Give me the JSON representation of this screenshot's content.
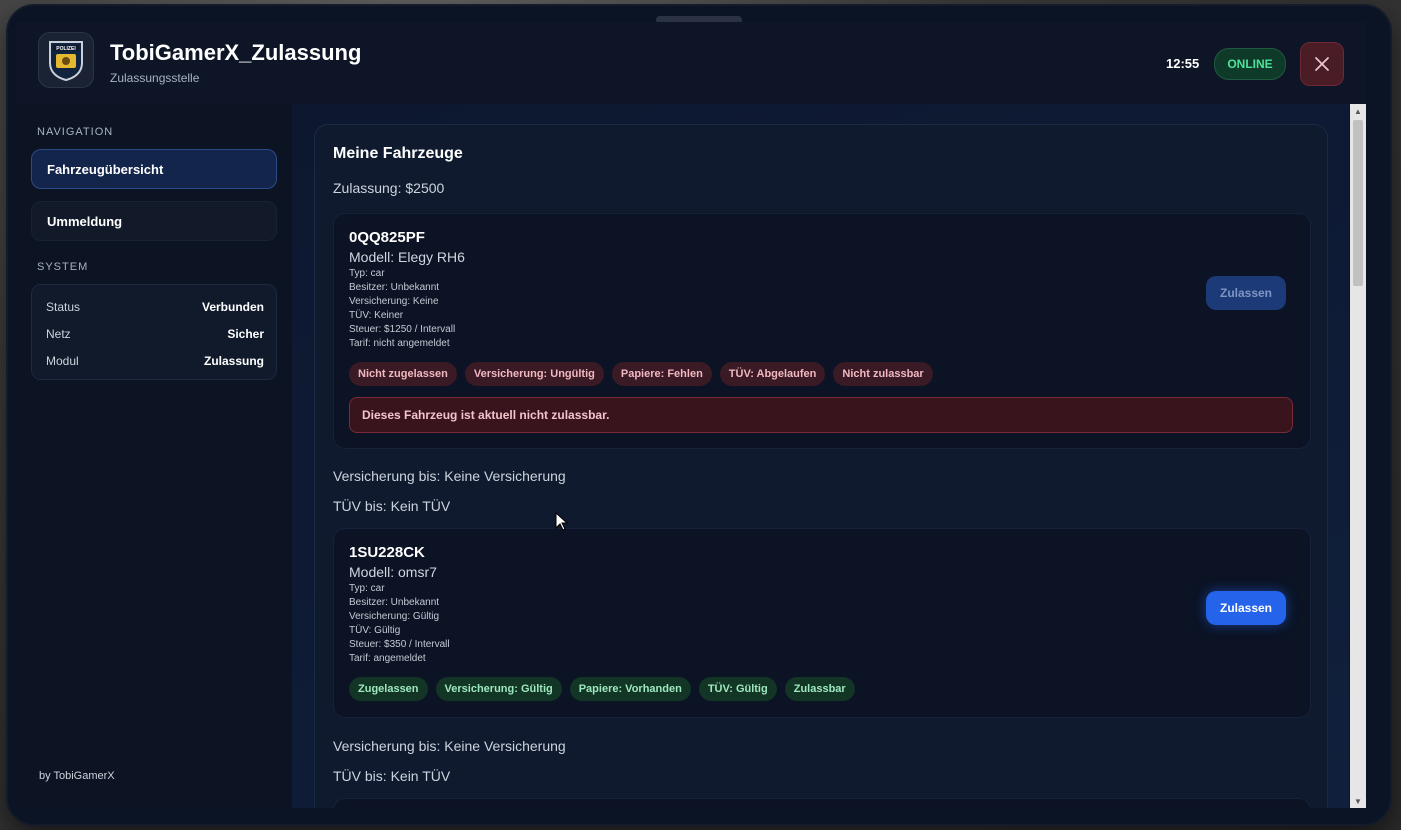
{
  "header": {
    "title": "TobiGamerX_Zulassung",
    "subtitle": "Zulassungsstelle",
    "logo_text": "POLIZEI",
    "clock": "12:55",
    "status_badge": "ONLINE",
    "close_icon": "close-icon"
  },
  "sidebar": {
    "nav_label": "NAVIGATION",
    "items": [
      {
        "label": "Fahrzeugübersicht",
        "active": true
      },
      {
        "label": "Ummeldung",
        "active": false
      }
    ],
    "system_label": "SYSTEM",
    "system": [
      {
        "key": "Status",
        "value": "Verbunden"
      },
      {
        "key": "Netz",
        "value": "Sicher"
      },
      {
        "key": "Modul",
        "value": "Zulassung"
      }
    ],
    "credit": "by TobiGamerX"
  },
  "main": {
    "title": "Meine Fahrzeuge",
    "fee": "Zulassung: $2500",
    "vehicles": [
      {
        "plate": "0QQ825PF",
        "model": "Modell: Elegy RH6",
        "type": "Typ: car",
        "owner": "Besitzer: Unbekannt",
        "insurance": "Versicherung: Keine",
        "tuv": "TÜV: Keiner",
        "tax": "Steuer: $1250 / Intervall",
        "tariff": "Tarif: nicht angemeldet",
        "button": "Zulassen",
        "button_enabled": false,
        "badges": [
          "Nicht zugelassen",
          "Versicherung: Ungültig",
          "Papiere: Fehlen",
          "TÜV: Abgelaufen",
          "Nicht zulassbar"
        ],
        "badge_color": "#3a1a24",
        "warning": "Dieses Fahrzeug ist aktuell nicht zulassbar.",
        "insurance_until": "Versicherung bis: Keine Versicherung",
        "tuv_until": "TÜV bis: Kein TÜV"
      },
      {
        "plate": "1SU228CK",
        "model": "Modell: omsr7",
        "type": "Typ: car",
        "owner": "Besitzer: Unbekannt",
        "insurance": "Versicherung: Gültig",
        "tuv": "TÜV: Gültig",
        "tax": "Steuer: $350 / Intervall",
        "tariff": "Tarif: angemeldet",
        "button": "Zulassen",
        "button_enabled": true,
        "badges": [
          "Zugelassen",
          "Versicherung: Gültig",
          "Papiere: Vorhanden",
          "TÜV: Gültig",
          "Zulassbar"
        ],
        "badge_color": "#123526",
        "insurance_until": "Versicherung bis: Keine Versicherung",
        "tuv_until": "TÜV bis: Kein TÜV"
      }
    ]
  },
  "colors": {
    "accent": "#2563eb",
    "online": "#4be39a",
    "danger_bg": "#3a141d"
  }
}
